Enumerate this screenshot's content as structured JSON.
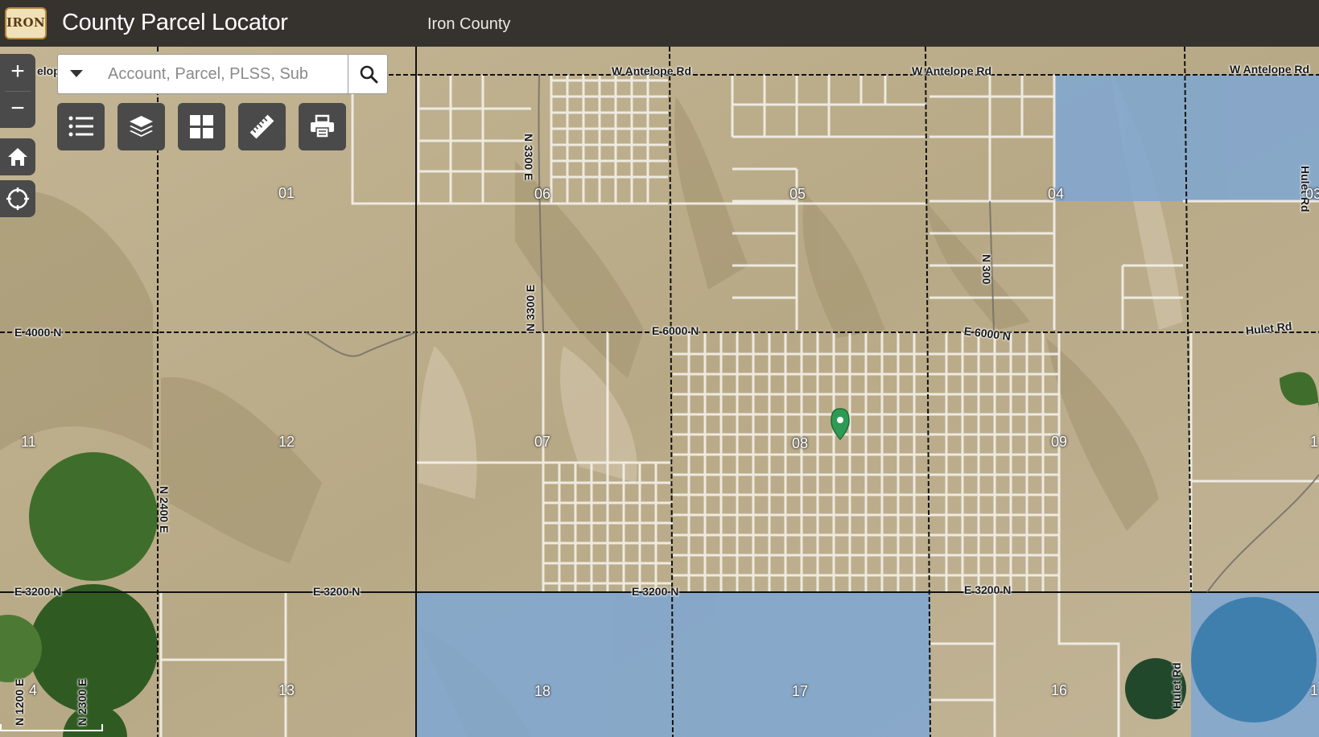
{
  "header": {
    "logo_text": "IRON",
    "title": "County Parcel Locator",
    "county": "Iron County"
  },
  "search": {
    "placeholder": "Account, Parcel, PLSS, Sub",
    "dropdown_icon": "chevron-down-icon",
    "search_icon": "search-icon"
  },
  "map_controls": {
    "zoom_in": "+",
    "zoom_out": "−",
    "home_icon": "home-icon",
    "locate_icon": "locate-icon"
  },
  "toolbar": [
    "legend-list-icon",
    "layers-icon",
    "basemap-grid-icon",
    "measure-ruler-icon",
    "print-icon"
  ],
  "map": {
    "road_labels": {
      "w_antelope_1": "W Antelope Rd",
      "w_antelope_2": "W Antelope Rd",
      "w_antelope_3": "W Antelope Rd",
      "antelope_partial": "elop",
      "n3300e_top": "N 3300 E",
      "n3300e_mid": "N 3300 E",
      "n300": "N 300",
      "hulet_top": "Hulet Rd",
      "e4000n": "E 4000 N",
      "e6000n_1": "E 6000 N",
      "e6000n_2": "E 6000 N",
      "hulet_rd": "Hulet Rd",
      "n2400e": "N 2400 E",
      "e3200n_1": "E 3200 N",
      "e3200n_2": "E 3200 N",
      "e3200n_3": "E 3200 N",
      "e3200n_4": "E 3200 N",
      "hulet_rd_2": "Hulet Rd",
      "n1200e": "N 1200 E",
      "n2300e": "N 2300 E"
    },
    "sections": {
      "s01": "01",
      "s06": "06",
      "s05": "05",
      "s04": "04",
      "s03": "03",
      "s11": "11",
      "s12": "12",
      "s07": "07",
      "s08": "08",
      "s09": "09",
      "s10": "1",
      "s14": "4",
      "s13": "13",
      "s18": "18",
      "s17": "17",
      "s16": "16",
      "s15": "1"
    },
    "colors": {
      "terrain": "#b9ab8c",
      "parcel_lines": "#f4f1ea",
      "section_lines": "#111111",
      "state_land": "#7fa7d3",
      "pivot_green": "#3f6e2c",
      "marker": "#2e9b55"
    }
  }
}
